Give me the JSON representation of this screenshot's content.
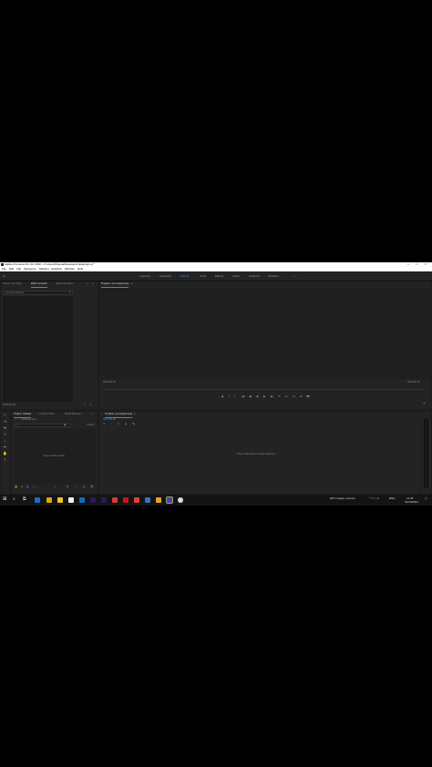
{
  "window": {
    "title": "Adobe Premiere Pro CC 2019 - C:\\Users\\Shayna\\Desktop\\Untitled.prproj *"
  },
  "menu": [
    "File",
    "Edit",
    "Clip",
    "Sequence",
    "Markers",
    "Graphics",
    "Window",
    "Help"
  ],
  "workspaces": {
    "items": [
      "Learning",
      "Assembly",
      "Editing",
      "Color",
      "Effects",
      "Audio",
      "Graphics",
      "Libraries"
    ],
    "active": "Editing",
    "more": "»"
  },
  "source_panel": {
    "tabs": [
      "Source: (no clips)",
      "Effect Controls",
      "Audio Clip Mixer"
    ],
    "active_tab": "Effect Controls",
    "menu_icon": "≡",
    "more": "»",
    "clip_selector": "(no clip selected)",
    "timecode": "00:00:00:00"
  },
  "program_monitor": {
    "tab": "Program: (no sequences)",
    "menu_icon": "≡",
    "timecode_left": "00:00:00:00",
    "timecode_right": "00:00:00:00",
    "transport": [
      "◆",
      "{",
      "}",
      "|◀",
      "◀|",
      "◀",
      "▶",
      "▶|",
      "⟲",
      "⊟",
      "⊡",
      "⊞",
      "📷"
    ],
    "add": "+"
  },
  "project_panel": {
    "tabs": [
      "Project: Untitled",
      "Content Cube",
      "Media Browser"
    ],
    "active_tab": "Project: Untitled",
    "more": "»",
    "file": "Untitled.prproj",
    "search_placeholder": "",
    "item_count": "0 Items",
    "empty_message": "Import media to start"
  },
  "timeline": {
    "tab": "Timeline: (no sequences)",
    "menu_icon": "≡",
    "timecode": "00;00;00;00",
    "empty_message": "Drop media here to create sequence."
  },
  "taskbar": {
    "weather": "28°C  Heavy t-storms",
    "language": "ENG",
    "time": "11:45",
    "date": "01/10/2021"
  }
}
